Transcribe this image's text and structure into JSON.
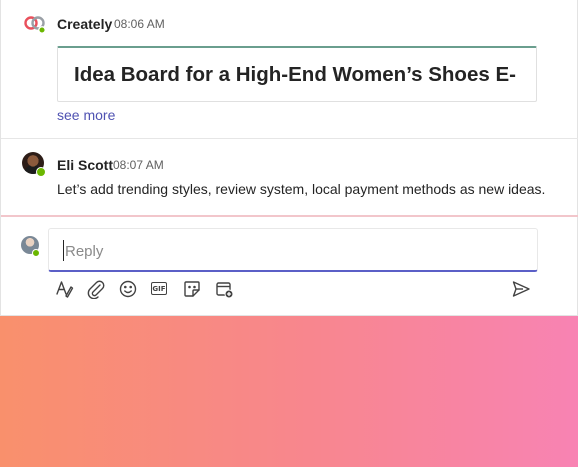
{
  "messages": [
    {
      "sender": "Creately",
      "time": "08:06 AM",
      "card_title": "Idea Board for a High-End Women’s Shoes E-",
      "see_more": "see more",
      "logo_icon": "creately-logo-icon"
    },
    {
      "sender": "Eli Scott",
      "time": "08:07 AM",
      "text": "Let’s add trending styles, review system, local payment methods as new ideas.",
      "avatar_icon": "avatar"
    }
  ],
  "reply": {
    "placeholder": "Reply",
    "value": ""
  },
  "toolbar": {
    "icons": [
      "format-icon",
      "attach-icon",
      "emoji-icon",
      "gif-icon",
      "sticker-icon",
      "schedule-meeting-icon"
    ],
    "gif_label": "GIF",
    "send_icon": "send-icon"
  },
  "colors": {
    "accent": "#5b5fc7",
    "link": "#4f52b2",
    "presence": "#6bb700",
    "card_accent": "#6a9e8e"
  }
}
